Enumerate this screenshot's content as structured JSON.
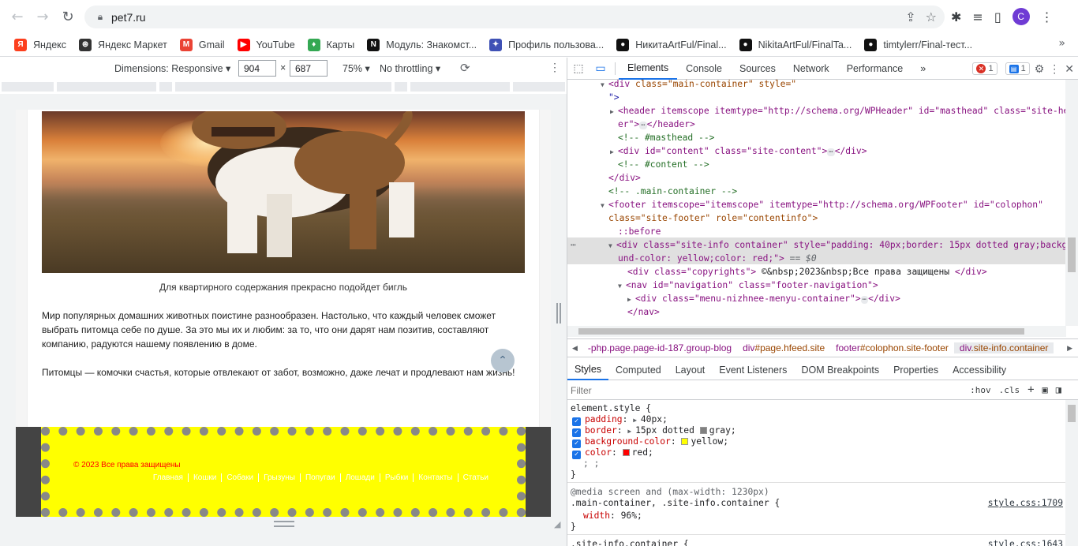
{
  "browser": {
    "url": "pet7.ru",
    "avatar_letter": "C",
    "bookmarks": [
      {
        "label": "Яндекс",
        "icon": "yandex-icon",
        "color": "#fc3f1d",
        "glyph": "Я"
      },
      {
        "label": "Яндекс Маркет",
        "icon": "market-icon",
        "color": "#333333",
        "glyph": "⊛"
      },
      {
        "label": "Gmail",
        "icon": "gmail-icon",
        "color": "#ea4335",
        "glyph": "M"
      },
      {
        "label": "YouTube",
        "icon": "youtube-icon",
        "color": "#ff0000",
        "glyph": "▶"
      },
      {
        "label": "Карты",
        "icon": "maps-icon",
        "color": "#34a853",
        "glyph": "♦"
      },
      {
        "label": "Модуль: Знакомст...",
        "icon": "notion-icon",
        "color": "#111111",
        "glyph": "N"
      },
      {
        "label": "Профиль пользова...",
        "icon": "profile-icon",
        "color": "#3f51b5",
        "glyph": "✦"
      },
      {
        "label": "НикитаArtFul/Final...",
        "icon": "github-icon",
        "color": "#111111",
        "glyph": "●"
      },
      {
        "label": "NikitaArtFul/FinalTa...",
        "icon": "github-icon",
        "color": "#111111",
        "glyph": "●"
      },
      {
        "label": "timtylerr/Final-тест...",
        "icon": "github-icon",
        "color": "#111111",
        "glyph": "●"
      }
    ]
  },
  "device_toolbar": {
    "dimensions_label": "Dimensions: Responsive",
    "width": "904",
    "height": "687",
    "zoom": "75%",
    "throttling": "No throttling"
  },
  "page": {
    "caption": "Для квартирного содержания прекрасно подойдет бигль",
    "para1_l1": "Мир популярных домашних животных поистине разнообразен. Настолько, что каждый человек сможет",
    "para1_l2": "выбрать питомца себе по душе. За это мы их и любим: за то, что они дарят нам позитив, составляют",
    "para1_l3": "компанию, радуются нашему появлению в доме.",
    "para2": "Питомцы — комочки счастья, которые отвлекают от забот, возможно, даже лечат и продлевают нам жизнь!",
    "footer": {
      "copyright": "© 2023 Все права защищены",
      "nav": [
        "Главная",
        "Кошки",
        "Собаки",
        "Грызуны",
        "Попугаи",
        "Лошади",
        "Рыбки",
        "Контакты",
        "Статьи"
      ]
    }
  },
  "devtools": {
    "tabs": [
      "Elements",
      "Console",
      "Sources",
      "Network",
      "Performance"
    ],
    "active_tab": "Elements",
    "errors_count": "1",
    "messages_count": "1",
    "dom": {
      "l1_tag": "<div",
      "l1_attrs": "class=\"main-container\" style=\"",
      "l2": "\">",
      "l3a": "<header itemscope itemtype=\"http://schema.org/WPHeader\" id=\"masthead\" class=\"site-head",
      "l3b": "er\">",
      "l3c": "</header>",
      "l4": "<!-- #masthead -->",
      "l5": "<div id=\"content\" class=\"site-content\">",
      "l5c": "</div>",
      "l6": "<!-- #content -->",
      "l7": "</div>",
      "l8": "<!-- .main-container -->",
      "l9": "<footer itemscope=\"itemscope\" itemtype=\"http://schema.org/WPFooter\" id=\"colophon\"",
      "l10": "class=\"site-footer\" role=\"contentinfo\">",
      "l11": "::before",
      "l12a": "<div class=\"site-info container\" style=\"padding: 40px;border: 15px dotted gray;backgro",
      "l12b": "und-color: yellow;color: red;\">",
      "l12c": "== $0",
      "l13": "<div class=\"copyrights\">",
      "l13b": "©&nbsp;2023&nbsp;Все права защищены",
      "l13c": "</div>",
      "l14": "<nav id=\"navigation\" class=\"footer-navigation\">",
      "l15": "<div class=\"menu-nizhnee-menyu-container\">",
      "l15c": "</div>",
      "l16": "</nav>"
    },
    "breadcrumbs": [
      {
        "tag": "-php.page.page-id-187.group-blog",
        "cls": ""
      },
      {
        "tag": "div",
        "cls": "#page.hfeed.site"
      },
      {
        "tag": "footer",
        "cls": "#colophon.site-footer"
      },
      {
        "tag": "div",
        "cls": ".site-info.container"
      }
    ],
    "sub_tabs": [
      "Styles",
      "Computed",
      "Layout",
      "Event Listeners",
      "DOM Breakpoints",
      "Properties",
      "Accessibility"
    ],
    "active_sub_tab": "Styles",
    "filter_placeholder": "Filter",
    "hov": ":hov",
    "cls": ".cls",
    "styles": {
      "element_style": "element.style {",
      "props": [
        {
          "name": "padding",
          "value": "40px;",
          "arrow": true,
          "swatch": ""
        },
        {
          "name": "border",
          "value": "15px dotted",
          "arrow": true,
          "swatch": "#808080",
          "value2": "gray;"
        },
        {
          "name": "background-color",
          "value": "",
          "arrow": false,
          "swatch": "#ffff00",
          "value2": "yellow;"
        },
        {
          "name": "color",
          "value": "",
          "arrow": false,
          "swatch": "#ff0000",
          "value2": "red;"
        }
      ],
      "semi": "; ;",
      "close": "}",
      "media": "@media screen and (max-width: 1230px)",
      "rule2_sel": ".main-container, .site-info.container {",
      "rule2_src": "style.css:1709",
      "rule2_prop": "width",
      "rule2_val": "96%;",
      "rule3_sel": ".site-info.container {",
      "rule3_src": "style.css:1643"
    }
  }
}
